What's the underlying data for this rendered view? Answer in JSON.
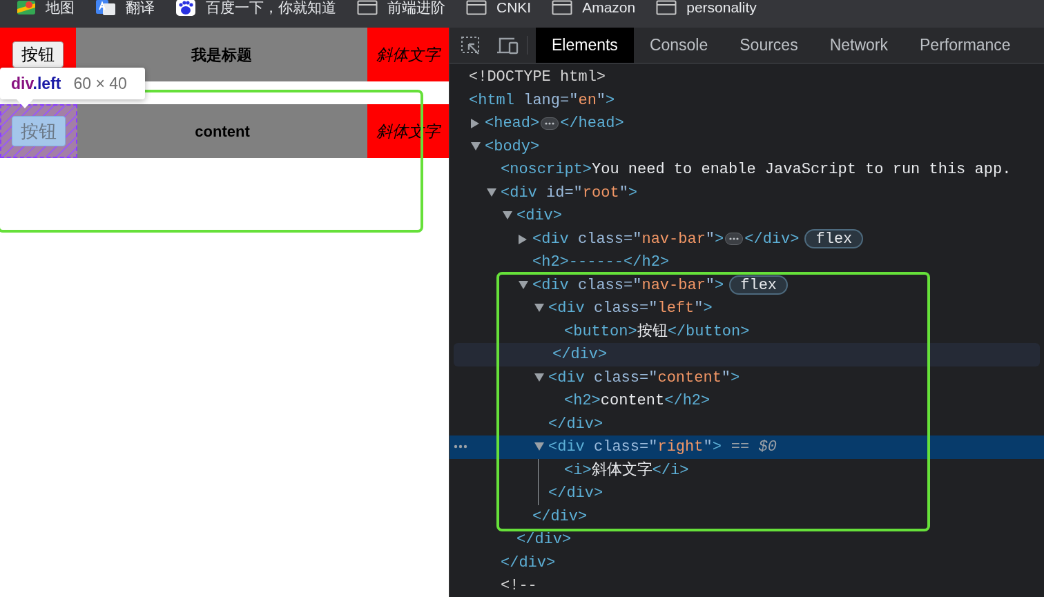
{
  "bookmarks": [
    {
      "label": "地图",
      "kind": "map-app"
    },
    {
      "label": "翻译",
      "kind": "translate-app"
    },
    {
      "label": "百度一下，你就知道",
      "kind": "paw-app"
    },
    {
      "label": "前端进阶",
      "kind": "folder"
    },
    {
      "label": "CNKI",
      "kind": "folder"
    },
    {
      "label": "Amazon",
      "kind": "folder"
    },
    {
      "label": "personality",
      "kind": "folder"
    }
  ],
  "page": {
    "rows": [
      {
        "button": "按钮",
        "title": "我是标题",
        "side": "斜体文字",
        "inspected": false
      },
      {
        "button": "按钮",
        "title": "content",
        "side": "斜体文字",
        "inspected": true
      }
    ],
    "tooltip": {
      "tag": "div",
      "class_name": ".left",
      "size": "60 × 40"
    }
  },
  "devtools": {
    "tabs": [
      {
        "label": "Elements",
        "selected": true
      },
      {
        "label": "Console",
        "selected": false
      },
      {
        "label": "Sources",
        "selected": false
      },
      {
        "label": "Network",
        "selected": false
      },
      {
        "label": "Performance",
        "selected": false
      }
    ],
    "tree": [
      {
        "selected": false,
        "open": [
          {
            "kind": "doctype",
            "text": "<!DOCTYPE html>"
          }
        ]
      },
      {
        "selected": false,
        "open": [
          {
            "kind": "tag",
            "text": "<html"
          },
          {
            "kind": "attr",
            "text": " lang=\""
          },
          {
            "kind": "value",
            "text": "en"
          },
          {
            "kind": "attr",
            "text": "\""
          },
          {
            "kind": "tag",
            "text": ">"
          }
        ],
        "children": [
          {
            "selected": false,
            "expanded": false,
            "open": [
              {
                "kind": "tag",
                "text": "<head>"
              },
              {
                "kind": "dots"
              },
              {
                "kind": "tag",
                "text": "</head>"
              }
            ]
          },
          {
            "selected": false,
            "expanded": true,
            "open": [
              {
                "kind": "tag",
                "text": "<body>"
              }
            ],
            "children": [
              {
                "selected": false,
                "open": [
                  {
                    "kind": "tag",
                    "text": "<noscript>"
                  },
                  {
                    "kind": "text",
                    "text": "You need to enable JavaScript to run this app."
                  }
                ]
              },
              {
                "selected": false,
                "expanded": true,
                "open": [
                  {
                    "kind": "tag",
                    "text": "<div"
                  },
                  {
                    "kind": "attr",
                    "text": " id=\""
                  },
                  {
                    "kind": "value",
                    "text": "root"
                  },
                  {
                    "kind": "attr",
                    "text": "\""
                  },
                  {
                    "kind": "tag",
                    "text": ">"
                  }
                ],
                "close": [
                  {
                    "kind": "tag",
                    "text": "</div>"
                  }
                ],
                "children": [
                  {
                    "selected": false,
                    "expanded": true,
                    "open": [
                      {
                        "kind": "tag",
                        "text": "<div>"
                      }
                    ],
                    "close": [
                      {
                        "kind": "tag",
                        "text": "</div>"
                      }
                    ],
                    "children": [
                      {
                        "selected": false,
                        "expanded": false,
                        "open": [
                          {
                            "kind": "tag",
                            "text": "<div"
                          },
                          {
                            "kind": "attr",
                            "text": " class=\""
                          },
                          {
                            "kind": "value",
                            "text": "nav-bar"
                          },
                          {
                            "kind": "attr",
                            "text": "\""
                          },
                          {
                            "kind": "tag",
                            "text": ">"
                          },
                          {
                            "kind": "dots"
                          },
                          {
                            "kind": "tag",
                            "text": "</div>"
                          },
                          {
                            "kind": "badge",
                            "text": "flex"
                          }
                        ]
                      },
                      {
                        "selected": false,
                        "open": [
                          {
                            "kind": "tag",
                            "text": "<h2>------</h2>"
                          }
                        ]
                      },
                      {
                        "selected": false,
                        "expanded": true,
                        "open": [
                          {
                            "kind": "tag",
                            "text": "<div"
                          },
                          {
                            "kind": "attr",
                            "text": " class=\""
                          },
                          {
                            "kind": "value",
                            "text": "nav-bar"
                          },
                          {
                            "kind": "attr",
                            "text": "\""
                          },
                          {
                            "kind": "tag",
                            "text": ">"
                          },
                          {
                            "kind": "badge",
                            "text": "flex"
                          }
                        ],
                        "close": [
                          {
                            "kind": "tag",
                            "text": "</div>"
                          }
                        ],
                        "children": [
                          {
                            "selected": false,
                            "expanded": true,
                            "close_hovered": true,
                            "open": [
                              {
                                "kind": "tag",
                                "text": "<div"
                              },
                              {
                                "kind": "attr",
                                "text": " class=\""
                              },
                              {
                                "kind": "value",
                                "text": "left"
                              },
                              {
                                "kind": "attr",
                                "text": "\""
                              },
                              {
                                "kind": "tag",
                                "text": ">"
                              }
                            ],
                            "close": [
                              {
                                "kind": "tag",
                                "text": "</div>"
                              }
                            ],
                            "children": [
                              {
                                "selected": false,
                                "open": [
                                  {
                                    "kind": "tag",
                                    "text": "<button>"
                                  },
                                  {
                                    "kind": "text",
                                    "text": "按钮"
                                  },
                                  {
                                    "kind": "tag",
                                    "text": "</button>"
                                  }
                                ]
                              }
                            ]
                          },
                          {
                            "selected": false,
                            "expanded": true,
                            "open": [
                              {
                                "kind": "tag",
                                "text": "<div"
                              },
                              {
                                "kind": "attr",
                                "text": " class=\""
                              },
                              {
                                "kind": "value",
                                "text": "content"
                              },
                              {
                                "kind": "attr",
                                "text": "\""
                              },
                              {
                                "kind": "tag",
                                "text": ">"
                              }
                            ],
                            "close": [
                              {
                                "kind": "tag",
                                "text": "</div>"
                              }
                            ],
                            "children": [
                              {
                                "selected": false,
                                "open": [
                                  {
                                    "kind": "tag",
                                    "text": "<h2>"
                                  },
                                  {
                                    "kind": "text",
                                    "text": "content"
                                  },
                                  {
                                    "kind": "tag",
                                    "text": "</h2>"
                                  }
                                ]
                              }
                            ]
                          },
                          {
                            "selected": true,
                            "expanded": true,
                            "open": [
                              {
                                "kind": "tag",
                                "text": "<div"
                              },
                              {
                                "kind": "attr",
                                "text": " class=\""
                              },
                              {
                                "kind": "value",
                                "text": "right"
                              },
                              {
                                "kind": "attr",
                                "text": "\""
                              },
                              {
                                "kind": "tag",
                                "text": ">"
                              },
                              {
                                "kind": "ref",
                                "text": "== $0"
                              }
                            ],
                            "close": [
                              {
                                "kind": "tag",
                                "text": "</div>"
                              }
                            ],
                            "children": [
                              {
                                "selected": false,
                                "open": [
                                  {
                                    "kind": "tag",
                                    "text": "<i>"
                                  },
                                  {
                                    "kind": "text",
                                    "text": "斜体文字"
                                  },
                                  {
                                    "kind": "tag",
                                    "text": "</i>"
                                  }
                                ]
                              }
                            ]
                          }
                        ]
                      }
                    ]
                  }
                ]
              },
              {
                "selected": false,
                "open": [
                  {
                    "kind": "comment",
                    "text": "<!--"
                  }
                ]
              }
            ]
          }
        ]
      }
    ]
  }
}
